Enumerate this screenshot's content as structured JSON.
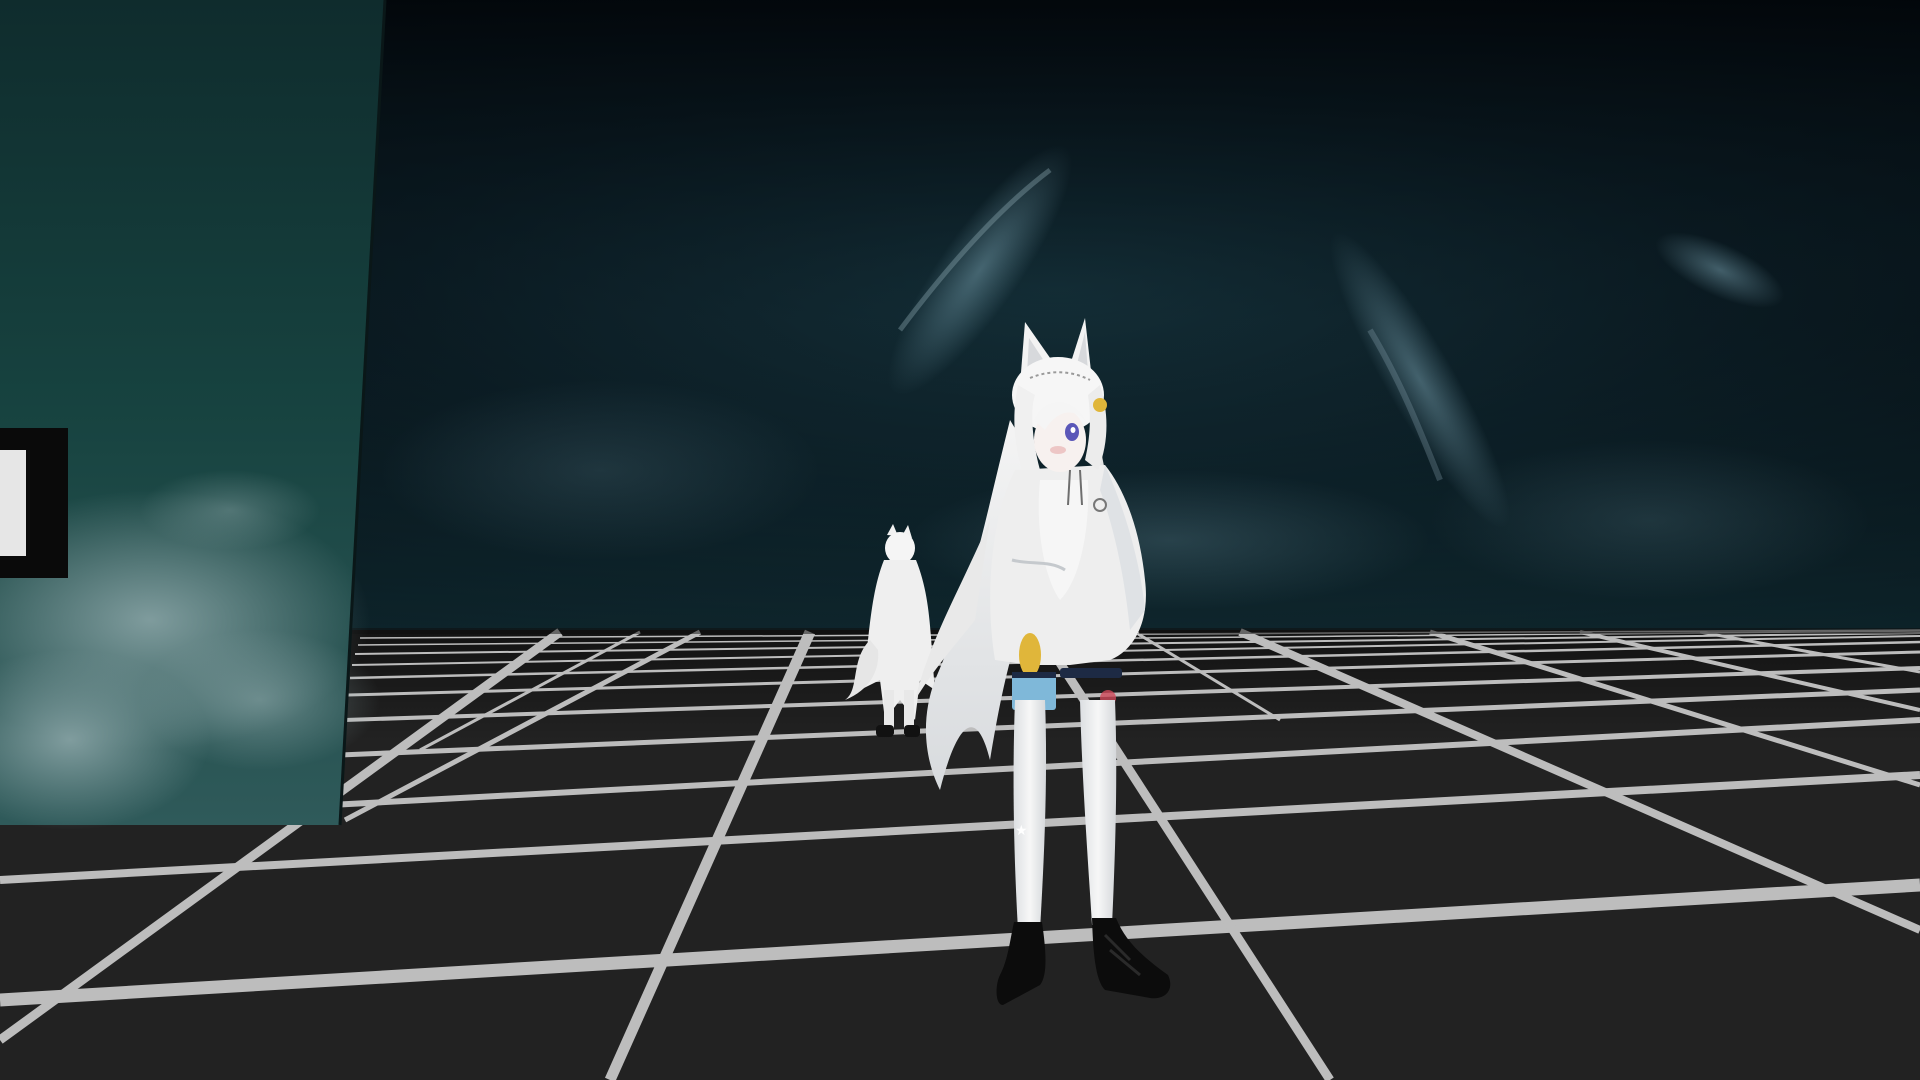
{
  "scene": {
    "type": "3d-vr-world-view",
    "environment": "nebula-skybox-with-grid-floor",
    "colors": {
      "sky_dark": "#03080c",
      "sky_mid": "#0f2a33",
      "nebula_highlight": "#5b7f8c",
      "panel_teal": "#163c3a",
      "floor_tile": "#232323",
      "floor_grid_line": "#bcbcbc",
      "avatar_white": "#ececec",
      "avatar_shadow": "#c9cdd2",
      "boot_black": "#0c0c0c",
      "accent_gold": "#e0b63a",
      "accent_blue": "#4d8fc4",
      "eye_purple": "#5b57b8"
    },
    "elements": {
      "left_wall_panel": "teal-cloud-wall-panel",
      "partial_frame": "black-framed-sign-edge",
      "main_avatar": "white-fox-eared-avatar",
      "background_avatar": "distant-white-fox-avatar"
    }
  }
}
